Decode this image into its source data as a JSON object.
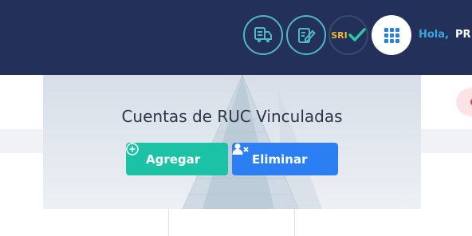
{
  "header": {
    "icons": [
      {
        "name": "truck-icon"
      },
      {
        "name": "edit-document-icon"
      },
      {
        "name": "sri-check-icon",
        "label": "SRI"
      }
    ],
    "apps_icon": "grid-apps-icon",
    "greeting": "Hola,",
    "username": "PR"
  },
  "card": {
    "title": "Cuentas de RUC Vinculadas",
    "buttons": {
      "add_label": "Agregar",
      "delete_label": "Eliminar"
    }
  },
  "colors": {
    "topbar": "#23305a",
    "accent_teal": "#1cc2a6",
    "accent_blue": "#2c7ff2",
    "icon_ring": "#4fb9c2"
  }
}
